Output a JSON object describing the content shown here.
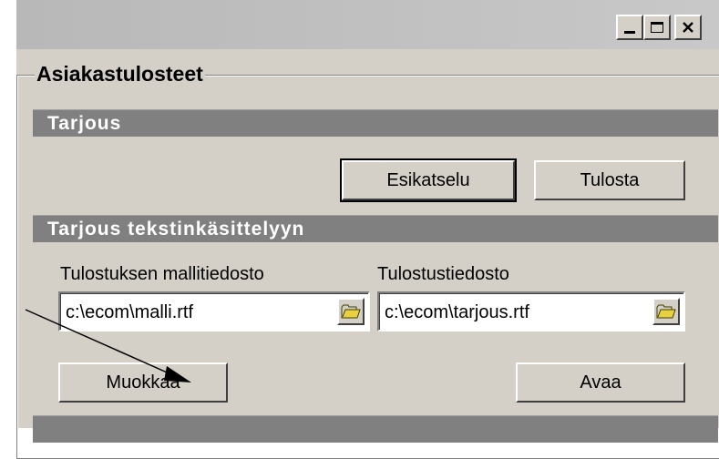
{
  "window": {
    "controls": {
      "minimize": "_",
      "maximize": "□",
      "close": "×"
    }
  },
  "group": {
    "title": "Asiakastulosteet"
  },
  "tarjous": {
    "header": "Tarjous",
    "preview_label": "Esikatselu",
    "print_label": "Tulosta"
  },
  "tekstinkasittely": {
    "header": "Tarjous tekstinkäsittelyyn",
    "template_label": "Tulostuksen mallitiedosto",
    "template_value": "c:\\ecom\\malli.rtf",
    "output_label": "Tulostustiedosto",
    "output_value": "c:\\ecom\\tarjous.rtf",
    "edit_label": "Muokkaa",
    "open_label": "Avaa"
  },
  "next_section": {
    "header": ""
  },
  "icons": {
    "browse": "folder-open-icon",
    "cursor": "arrow-pointer-icon"
  },
  "colors": {
    "face": "#d4d0c8",
    "header": "#808080",
    "folder": "#e8d040"
  }
}
